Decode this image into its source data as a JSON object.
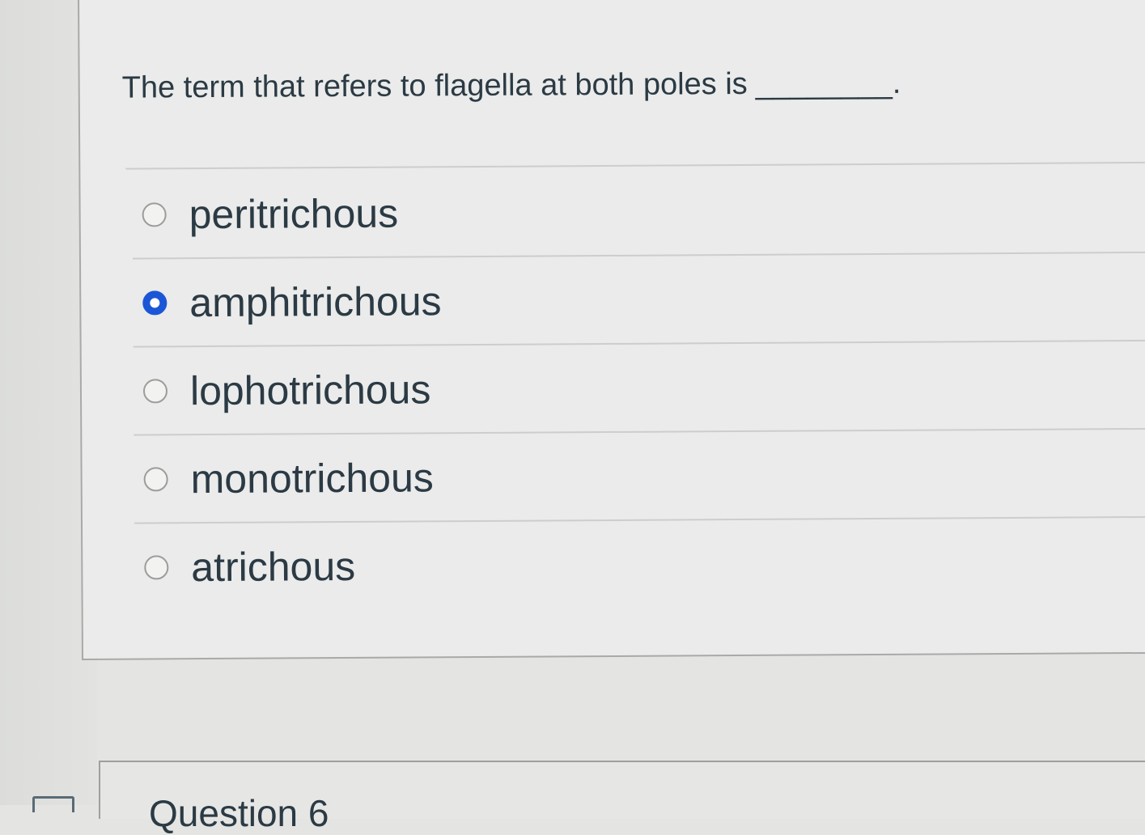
{
  "question": {
    "text": "The term that refers to flagella at both poles is",
    "blank": "________."
  },
  "answers": [
    {
      "label": "peritrichous",
      "selected": false
    },
    {
      "label": "amphitrichous",
      "selected": true
    },
    {
      "label": "lophotrichous",
      "selected": false
    },
    {
      "label": "monotrichous",
      "selected": false
    },
    {
      "label": "atrichous",
      "selected": false
    }
  ],
  "next_question": {
    "title": "Question 6"
  },
  "colors": {
    "selected_radio": "#1b56d6",
    "text": "#2b3a44",
    "background": "#e4e5e3"
  },
  "icons": {
    "flag": "flag-icon"
  }
}
